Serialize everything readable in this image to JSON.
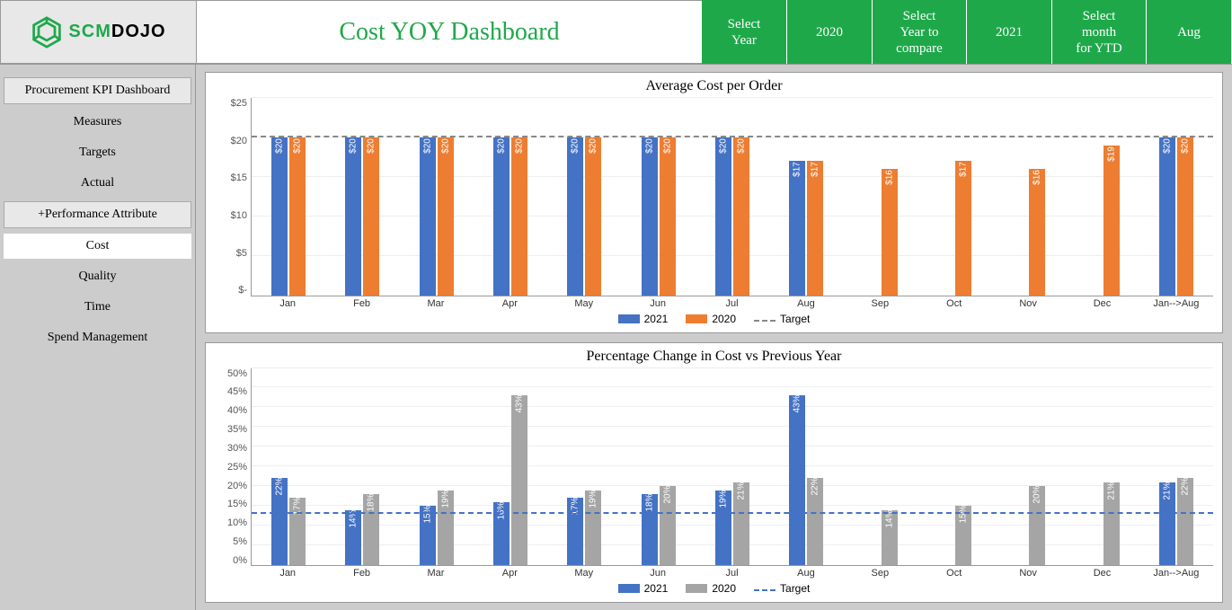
{
  "logo": {
    "text1": "SCM",
    "text2": "DOJO"
  },
  "title": "Cost YOY Dashboard",
  "selectors": [
    {
      "label": "Select\nYear",
      "value": ""
    },
    {
      "label": "2020",
      "value": ""
    },
    {
      "label": "Select\nYear to\ncompare",
      "value": ""
    },
    {
      "label": "2021",
      "value": ""
    },
    {
      "label": "Select\nmonth\nfor YTD",
      "value": ""
    },
    {
      "label": "Aug",
      "value": ""
    }
  ],
  "sidebar": {
    "hdr1": "Procurement KPI Dashboard",
    "items1": [
      "Measures",
      "Targets",
      "Actual"
    ],
    "hdr2": "+Performance Attribute",
    "items2": [
      "Cost",
      "Quality",
      "Time",
      "Spend Management"
    ],
    "selected": "Cost"
  },
  "chart_data": [
    {
      "type": "bar",
      "title": "Average Cost per Order",
      "xlabel": "",
      "ylabel": "",
      "ylim": [
        0,
        25
      ],
      "yticks": [
        "$-",
        "$5",
        "$10",
        "$15",
        "$20",
        "$25"
      ],
      "categories": [
        "Jan",
        "Feb",
        "Mar",
        "Apr",
        "May",
        "Jun",
        "Jul",
        "Aug",
        "Sep",
        "Oct",
        "Nov",
        "Dec",
        "Jan-->Aug"
      ],
      "target": 20,
      "series": [
        {
          "name": "2021",
          "color": "blue",
          "values": [
            20,
            20,
            20,
            20,
            20,
            20,
            20,
            17,
            null,
            null,
            null,
            null,
            20
          ],
          "labels": [
            "$20",
            "$20",
            "$20",
            "$20",
            "$20",
            "$20",
            "$20",
            "$17",
            "",
            "",
            "",
            "",
            "$20"
          ]
        },
        {
          "name": "2020",
          "color": "orange",
          "values": [
            20,
            20,
            20,
            20,
            20,
            20,
            20,
            17,
            16,
            17,
            16,
            19,
            20
          ],
          "labels": [
            "$20",
            "$20",
            "$20",
            "$20",
            "$20",
            "$20",
            "$20",
            "$17",
            "$16",
            "$17",
            "$16",
            "$19",
            "$20"
          ]
        }
      ],
      "legend": [
        "2021",
        "2020",
        "Target"
      ]
    },
    {
      "type": "bar",
      "title": "Percentage Change in Cost vs Previous Year",
      "xlabel": "",
      "ylabel": "",
      "ylim": [
        0,
        50
      ],
      "yticks": [
        "0%",
        "5%",
        "10%",
        "15%",
        "20%",
        "25%",
        "30%",
        "35%",
        "40%",
        "45%",
        "50%"
      ],
      "categories": [
        "Jan",
        "Feb",
        "Mar",
        "Apr",
        "May",
        "Jun",
        "Jul",
        "Aug",
        "Sep",
        "Oct",
        "Nov",
        "Dec",
        "Jan-->Aug"
      ],
      "target": 13,
      "series": [
        {
          "name": "2021",
          "color": "blue",
          "values": [
            22,
            14,
            15,
            16,
            17,
            18,
            19,
            43,
            null,
            null,
            null,
            null,
            21
          ],
          "labels": [
            "22%",
            "14%",
            "15%",
            "16%",
            "17%",
            "18%",
            "19%",
            "43%",
            "",
            "",
            "",
            "",
            "21%"
          ]
        },
        {
          "name": "2020",
          "color": "grey",
          "values": [
            17,
            18,
            19,
            43,
            19,
            20,
            21,
            22,
            14,
            15,
            20,
            21,
            22
          ],
          "labels": [
            "17%",
            "18%",
            "19%",
            "43%",
            "19%",
            "20%",
            "21%",
            "22%",
            "14%",
            "15%",
            "20%",
            "21%",
            "22%"
          ]
        }
      ],
      "legend": [
        "2021",
        "2020",
        "Target"
      ]
    }
  ]
}
